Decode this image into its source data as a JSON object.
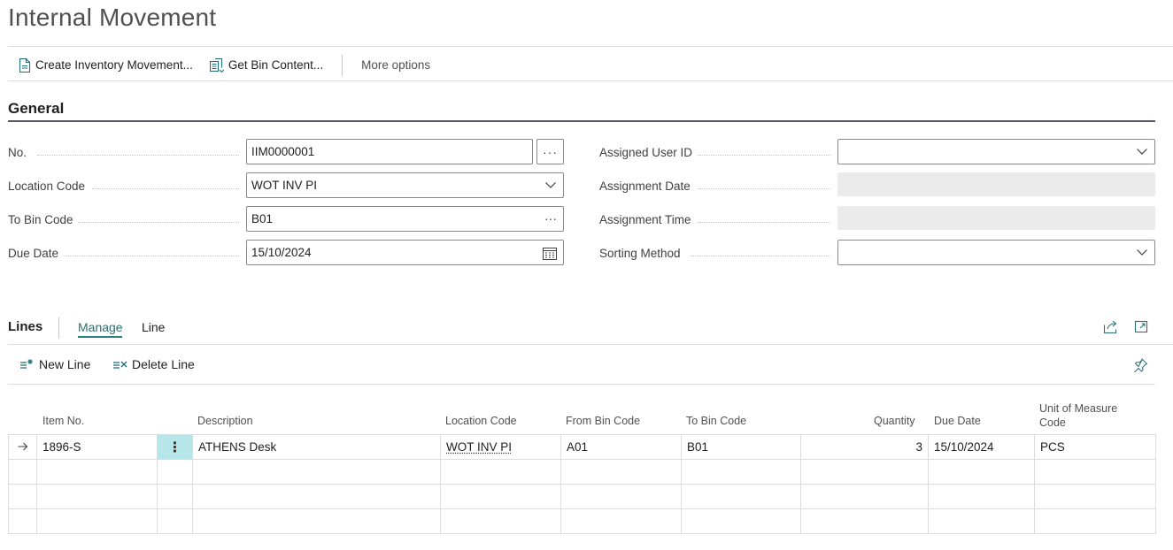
{
  "page": {
    "title": "Internal Movement"
  },
  "actions": {
    "create_inventory_movement": "Create Inventory Movement...",
    "get_bin_content": "Get Bin Content...",
    "more_options": "More options"
  },
  "general": {
    "title": "General",
    "no": {
      "label": "No.",
      "value": "IIM0000001"
    },
    "location_code": {
      "label": "Location Code",
      "value": "WOT INV PI"
    },
    "to_bin_code": {
      "label": "To Bin Code",
      "value": "B01"
    },
    "due_date": {
      "label": "Due Date",
      "value": "15/10/2024"
    },
    "assigned_user_id": {
      "label": "Assigned User ID",
      "value": ""
    },
    "assignment_date": {
      "label": "Assignment Date",
      "value": ""
    },
    "assignment_time": {
      "label": "Assignment Time",
      "value": ""
    },
    "sorting_method": {
      "label": "Sorting Method",
      "value": ""
    }
  },
  "lines": {
    "title": "Lines",
    "tabs": [
      "Manage",
      "Line"
    ],
    "new_line": "New Line",
    "delete_line": "Delete Line",
    "columns": {
      "item_no": "Item No.",
      "description": "Description",
      "location_code": "Location Code",
      "from_bin_code": "From Bin Code",
      "to_bin_code": "To Bin Code",
      "quantity": "Quantity",
      "due_date": "Due Date",
      "unit_of_measure_code_1": "Unit of Measure",
      "unit_of_measure_code_2": "Code"
    },
    "rows": [
      {
        "item_no": "1896-S",
        "description": "ATHENS Desk",
        "location_code": "WOT INV PI",
        "from_bin_code": "A01",
        "to_bin_code": "B01",
        "quantity": "3",
        "due_date": "15/10/2024",
        "uom": "PCS"
      }
    ]
  },
  "colors": {
    "accent": "#2b7f7f",
    "selected_cell": "#b7e6ea",
    "section_rule": "#505a66"
  }
}
